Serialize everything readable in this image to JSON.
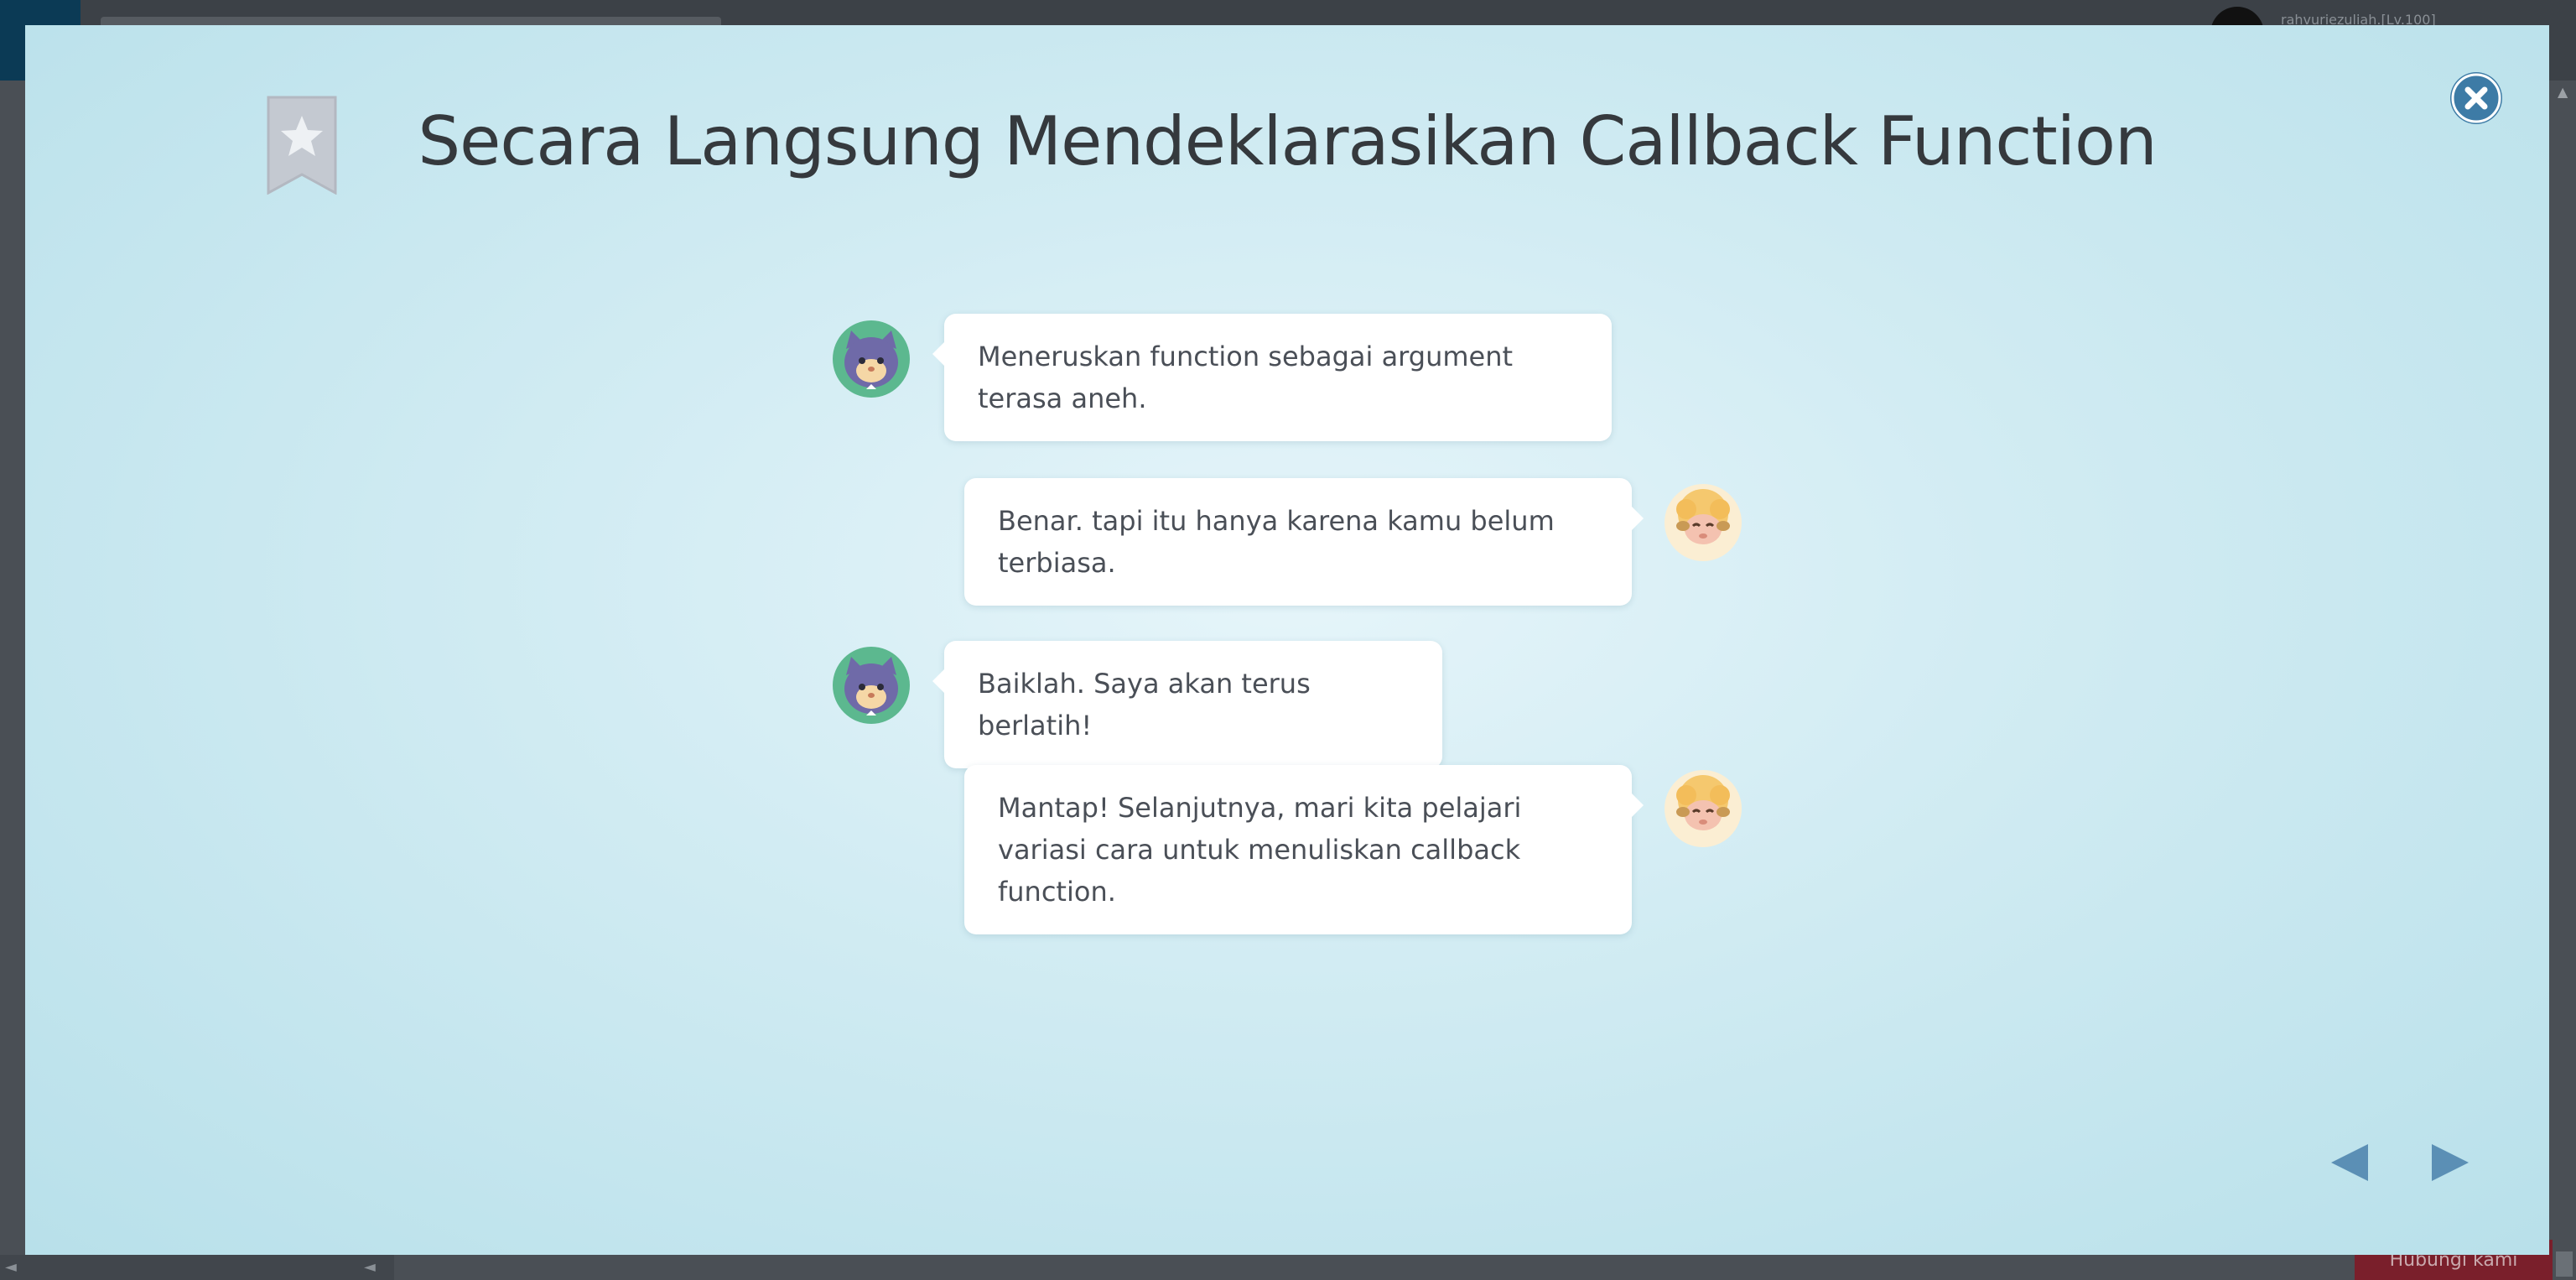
{
  "background": {
    "username": "rahvuriezuliah.[Lv.100]",
    "bottom_button": "Hubungi kami",
    "bottom_arrows": [
      "◄",
      "◄"
    ]
  },
  "modal": {
    "title": "Secara Langsung Mendeklarasikan Callback Function",
    "bookmark_icon": "bookmark-star-icon",
    "close_icon": "close-x-icon",
    "messages": [
      {
        "speaker": "cat",
        "side": "left",
        "text": "Meneruskan function sebagai argument terasa aneh."
      },
      {
        "speaker": "sheep",
        "side": "right",
        "text": "Benar. tapi itu hanya karena kamu belum terbiasa."
      },
      {
        "speaker": "cat",
        "side": "left",
        "text": "Baiklah. Saya akan terus berlatih!"
      },
      {
        "speaker": "sheep",
        "side": "right",
        "text": "Mantap! Selanjutnya, mari kita pelajari variasi cara untuk menuliskan callback function."
      }
    ],
    "nav": {
      "prev_icon": "arrow-left-icon",
      "next_icon": "arrow-right-icon"
    }
  },
  "colors": {
    "accent": "#3d7ba6",
    "nav_arrow": "#5b8fb5",
    "bookmark": "#c4c9d1",
    "title_text": "#35393d",
    "bubble_text": "#4a4f57"
  }
}
